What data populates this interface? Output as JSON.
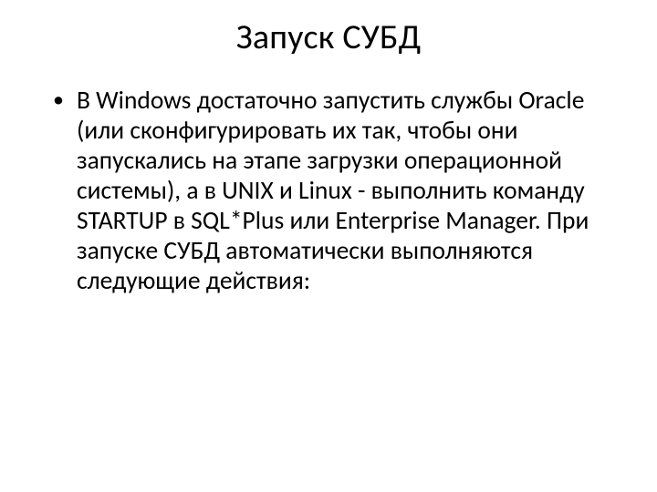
{
  "slide": {
    "title": "Запуск СУБД",
    "bullets": [
      "В Windows достаточно запустить службы Oracle (или сконфигурировать их так, чтобы они запускались на этапе загрузки операционной системы), а в UNIX и Linux - выполнить команду STARTUP в SQL*Plus или Enterprise Manager. При запуске СУБД автоматически выполняются следующие действия:"
    ]
  }
}
